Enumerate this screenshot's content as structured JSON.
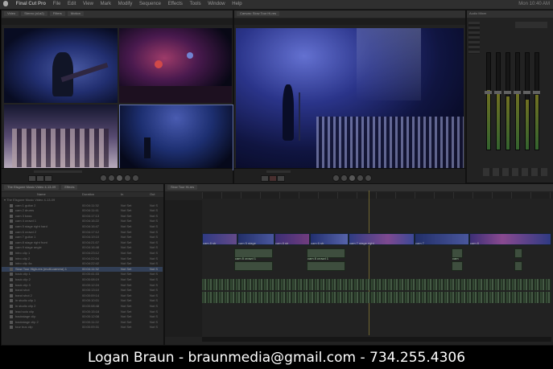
{
  "menubar": {
    "app": "Final Cut Pro",
    "items": [
      "File",
      "Edit",
      "View",
      "Mark",
      "Modify",
      "Sequence",
      "Effects",
      "Tools",
      "Window",
      "Help"
    ],
    "clock": "Mon 10:40 AM"
  },
  "viewer": {
    "tabs": [
      "Video",
      "Stereo (a1a2)",
      "Filters",
      "Motion"
    ]
  },
  "canvas": {
    "title": "Canvas: Slow Tour Hi-res"
  },
  "audio_mixer": {
    "title": "Audio Mixer",
    "level_colors": [
      "#3f7a3a",
      "#8a8a2a"
    ],
    "channel_levels": [
      0.62,
      0.58,
      0.55,
      0.6,
      0.52,
      0.57
    ]
  },
  "browser": {
    "title": "Browser",
    "project_tab": "The Elsgone Music Video 4-13-09",
    "effects_tab": "Effects",
    "columns": [
      "Name",
      "Duration",
      "In",
      "Out"
    ],
    "root": "The Elsgone Music Video 4-13-09",
    "rows": [
      {
        "name": "cam 1 guitar 2",
        "duration": "00:04:11:32",
        "in": "Not Set",
        "out": "Not S"
      },
      {
        "name": "cam 2 drums",
        "duration": "00:04:11:41",
        "in": "Not Set",
        "out": "Not S"
      },
      {
        "name": "cam 3 bass",
        "duration": "00:04:17:13",
        "in": "Not Set",
        "out": "Not S"
      },
      {
        "name": "cam 4 crowd 1",
        "duration": "00:04:16:22",
        "in": "Not Set",
        "out": "Not S"
      },
      {
        "name": "cam 5 stage right hard",
        "duration": "00:04:16:47",
        "in": "Not Set",
        "out": "Not S"
      },
      {
        "name": "cam 6 crowd 2",
        "duration": "00:04:17:12",
        "in": "Not Set",
        "out": "Not S"
      },
      {
        "name": "cam 7 guitar 1",
        "duration": "00:04:19:10",
        "in": "Not Set",
        "out": "Not S"
      },
      {
        "name": "cam 8 stage right front",
        "duration": "00:04:21:07",
        "in": "Not Set",
        "out": "Not S"
      },
      {
        "name": "cam 9 stage angle",
        "duration": "00:04:16:48",
        "in": "Not Set",
        "out": "Not S"
      },
      {
        "name": "intro clip 1",
        "duration": "00:04:23:12",
        "in": "Not Set",
        "out": "Not S"
      },
      {
        "name": "intro clip 2",
        "duration": "00:04:22:04",
        "in": "Not Set",
        "out": "Not S"
      },
      {
        "name": "intro clip 4a",
        "duration": "00:04:22:42",
        "in": "Not Set",
        "out": "Not S"
      },
      {
        "name": "Slow Tour High-res (multi-camera) 1",
        "duration": "00:04:11:32",
        "in": "Not Set",
        "out": "Not S"
      },
      {
        "name": "back clip 1",
        "duration": "00:00:41:33",
        "in": "Not Set",
        "out": "Not S"
      },
      {
        "name": "back clip 2",
        "duration": "00:00:08:19",
        "in": "Not Set",
        "out": "Not S"
      },
      {
        "name": "back clip 3",
        "duration": "00:00:12:24",
        "in": "Not Set",
        "out": "Not S"
      },
      {
        "name": "band shot",
        "duration": "00:00:13:10",
        "in": "Not Set",
        "out": "Not S"
      },
      {
        "name": "band shot 2",
        "duration": "00:00:09:14",
        "in": "Not Set",
        "out": "Not S"
      },
      {
        "name": "in studio clip 1",
        "duration": "00:00:10:01",
        "in": "Not Set",
        "out": "Not S"
      },
      {
        "name": "in studio clip 2",
        "duration": "00:00:08:48",
        "in": "Not Set",
        "out": "Not S"
      },
      {
        "name": "lead solo clip",
        "duration": "00:00:15:18",
        "in": "Not Set",
        "out": "Not S"
      },
      {
        "name": "backstage clip",
        "duration": "00:00:12:08",
        "in": "Not Set",
        "out": "Not S"
      },
      {
        "name": "backstage clip 2",
        "duration": "00:00:11:22",
        "in": "Not Set",
        "out": "Not S"
      },
      {
        "name": "tour bus clip",
        "duration": "00:00:09:31",
        "in": "Not Set",
        "out": "Not S"
      }
    ]
  },
  "timeline": {
    "tab": "Slow Tour Hi-res",
    "video_clip_labels": [
      "cam 8 str",
      "cam 5 stage",
      "cam 8 str",
      "cam 6 str",
      "cam 7 stage right",
      "cam 7",
      "cam 8"
    ],
    "audio_clip_labels": [
      "cam 8 crowd 1",
      "cam 8 crowd 1",
      "cam"
    ]
  },
  "footer": {
    "text": "Logan Braun - braunmedia@gmail.com - 734.255.4306"
  }
}
